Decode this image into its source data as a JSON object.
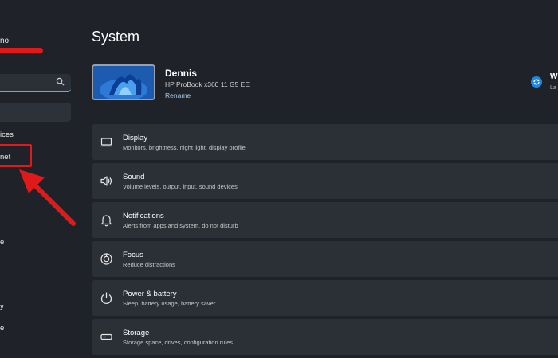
{
  "sidebar": {
    "user_name_fragment": "no",
    "search_placeholder": "",
    "items": [
      {
        "label": "ices"
      },
      {
        "label": "net"
      }
    ],
    "fragments": [
      {
        "label": "e"
      },
      {
        "label": "y"
      },
      {
        "label": "e"
      }
    ]
  },
  "page": {
    "title": "System"
  },
  "device": {
    "name": "Dennis",
    "model": "HP ProBook x360 11 G5 EE",
    "rename_label": "Rename"
  },
  "update": {
    "title": "W",
    "subtitle": "La"
  },
  "cards": [
    {
      "title": "Display",
      "desc": "Monitors, brightness, night light, display profile",
      "icon": "monitor-icon"
    },
    {
      "title": "Sound",
      "desc": "Volume levels, output, input, sound devices",
      "icon": "speaker-icon"
    },
    {
      "title": "Notifications",
      "desc": "Alerts from apps and system, do not disturb",
      "icon": "bell-icon"
    },
    {
      "title": "Focus",
      "desc": "Reduce distractions",
      "icon": "focus-icon"
    },
    {
      "title": "Power & battery",
      "desc": "Sleep, battery usage, battery saver",
      "icon": "power-icon"
    },
    {
      "title": "Storage",
      "desc": "Storage space, drives, configuration rules",
      "icon": "storage-icon"
    }
  ],
  "colors": {
    "background": "#1f2329",
    "card": "#2b2f36",
    "accent": "#4fb3e8",
    "annotation_red": "#e0191b"
  }
}
